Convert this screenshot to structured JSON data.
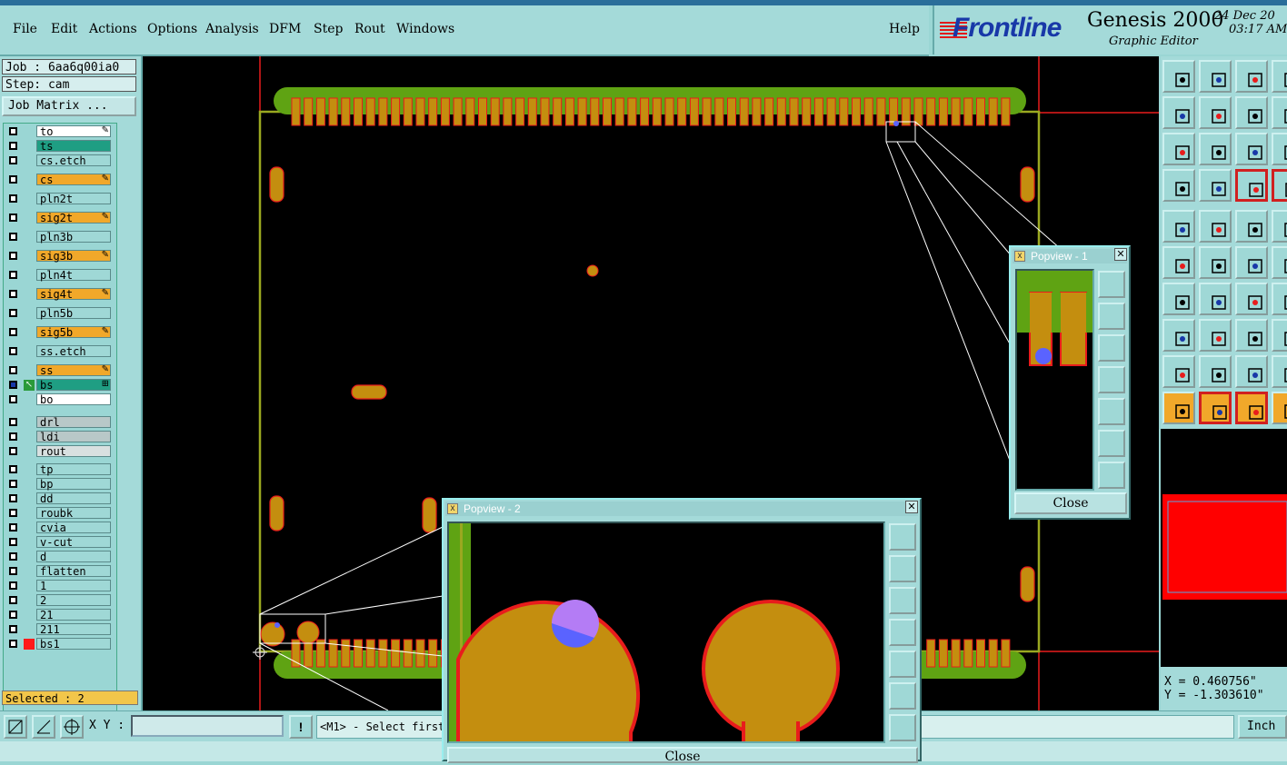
{
  "menubar": {
    "items": [
      "File",
      "Edit",
      "Actions",
      "Options",
      "Analysis",
      "DFM",
      "Step",
      "Rout",
      "Windows"
    ],
    "help": "Help"
  },
  "brand": {
    "logo": "Frontline",
    "product": "Genesis 2000",
    "subtitle": "Graphic Editor",
    "date": "24 Dec 20",
    "time": "03:17 AM"
  },
  "job": {
    "job_label": "Job : 6aa6q00ia0",
    "step_label": "Step: cam",
    "matrix_button": "Job Matrix ..."
  },
  "layers": [
    {
      "name": "to",
      "color": "#ffffff",
      "mark": "✎"
    },
    {
      "name": "ts",
      "color": "#1f9e83",
      "mark": ""
    },
    {
      "name": "cs.etch",
      "color": "#9fd8d6",
      "mark": ""
    },
    {
      "name": "cs",
      "color": "#f1a82a",
      "mark": "✎"
    },
    {
      "name": "pln2t",
      "color": "#9fd8d6",
      "mark": ""
    },
    {
      "name": "sig2t",
      "color": "#f1a82a",
      "mark": "✎"
    },
    {
      "name": "pln3b",
      "color": "#9fd8d6",
      "mark": ""
    },
    {
      "name": "sig3b",
      "color": "#f1a82a",
      "mark": "✎"
    },
    {
      "name": "pln4t",
      "color": "#9fd8d6",
      "mark": ""
    },
    {
      "name": "sig4t",
      "color": "#f1a82a",
      "mark": "✎"
    },
    {
      "name": "pln5b",
      "color": "#9fd8d6",
      "mark": ""
    },
    {
      "name": "sig5b",
      "color": "#f1a82a",
      "mark": "✎"
    },
    {
      "name": "ss.etch",
      "color": "#9fd8d6",
      "mark": ""
    },
    {
      "name": "ss",
      "color": "#f1a82a",
      "mark": "✎"
    },
    {
      "name": "bs",
      "color": "#1f9e83",
      "mark": "⊞"
    },
    {
      "name": "bo",
      "color": "#ffffff",
      "mark": ""
    },
    {
      "name": "drl",
      "color": "#b8c8c8",
      "mark": ""
    },
    {
      "name": "ldi",
      "color": "#b8c8c8",
      "mark": ""
    },
    {
      "name": "rout",
      "color": "#d8e0e0",
      "mark": ""
    },
    {
      "name": "tp",
      "color": "#9fd8d6",
      "mark": ""
    },
    {
      "name": "bp",
      "color": "#9fd8d6",
      "mark": ""
    },
    {
      "name": "dd",
      "color": "#9fd8d6",
      "mark": ""
    },
    {
      "name": "roubk",
      "color": "#9fd8d6",
      "mark": ""
    },
    {
      "name": "cvia",
      "color": "#9fd8d6",
      "mark": ""
    },
    {
      "name": "v-cut",
      "color": "#9fd8d6",
      "mark": ""
    },
    {
      "name": "d",
      "color": "#9fd8d6",
      "mark": ""
    },
    {
      "name": "flatten",
      "color": "#9fd8d6",
      "mark": ""
    },
    {
      "name": "1",
      "color": "#9fd8d6",
      "mark": ""
    },
    {
      "name": "2",
      "color": "#9fd8d6",
      "mark": ""
    },
    {
      "name": "21",
      "color": "#9fd8d6",
      "mark": ""
    },
    {
      "name": "211",
      "color": "#9fd8d6",
      "mark": ""
    },
    {
      "name": "bs1",
      "color": "#9fd8d6",
      "mark": ""
    }
  ],
  "selected": "Selected : 2",
  "popview1": {
    "title": "Popview - 1",
    "close": "Close"
  },
  "popview2": {
    "title": "Popview - 2",
    "close": "Close"
  },
  "coords": {
    "x": "X = 0.460756\"",
    "y": "Y = -1.303610\""
  },
  "bottom": {
    "xy_label": "X Y :",
    "xy_value": "",
    "exclaim": "!",
    "message": "<M1> - Select first",
    "unit": "Inch"
  },
  "toolbar_icons": [
    "zoom-home-icon",
    "zoom-up-icon",
    "home-icon",
    "page-icon",
    "pan-left-icon",
    "pan-right-icon",
    "undo-zoom-icon",
    "redo-icon",
    "fit-icon",
    "center-icon",
    "one-to-one-icon",
    "square-icon",
    "options-icon",
    "probe-icon",
    "snap-icon",
    "snap2-icon",
    "select-icon",
    "select-frame-icon",
    "ruler-icon",
    "grid-icon",
    "net-icon",
    "cross-icon",
    "move-icon",
    "move2-icon",
    "line-icon",
    "line2-icon",
    "arc-icon",
    "arc2-icon",
    "pad-icon",
    "minus-icon",
    "measure-icon",
    "measure2-icon",
    "triangle-icon",
    "triangle2-icon",
    "triangle3-icon",
    "triangle4-icon",
    "pointer-icon",
    "pointer-box-icon",
    "pointer-circle-icon",
    "pointer-extra-icon"
  ],
  "colors": {
    "ui_bg": "#a4dad9",
    "board_outline": "#9aa820",
    "soldermask": "#5fa313",
    "copper": "#c48e0f",
    "pad_edge": "#e81c1c",
    "highlight": "#5a63ff",
    "probe": "#b47cf5",
    "route_frame": "#e81c1c"
  }
}
